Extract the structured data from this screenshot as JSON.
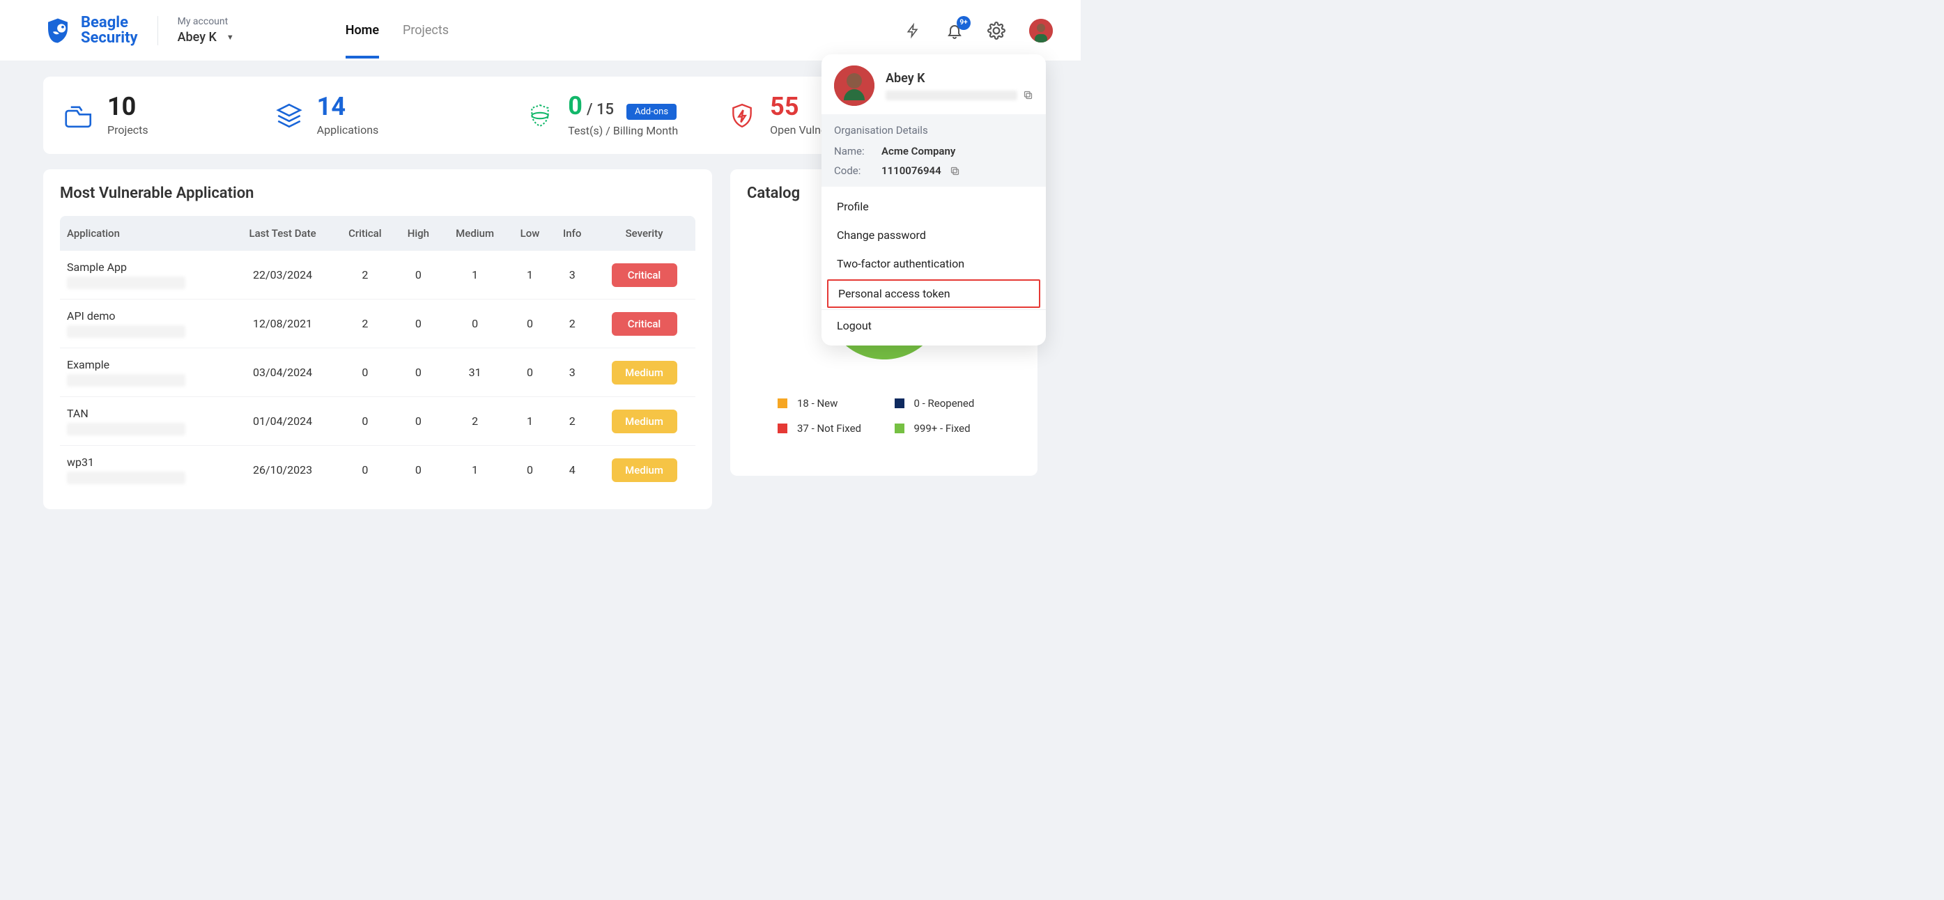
{
  "brand": {
    "line1": "Beagle",
    "line2": "Security"
  },
  "account": {
    "label": "My account",
    "name": "Abey K"
  },
  "nav": {
    "tabs": [
      {
        "label": "Home",
        "active": true
      },
      {
        "label": "Projects",
        "active": false
      }
    ]
  },
  "header": {
    "notif_badge": "9+"
  },
  "stats": {
    "projects": {
      "value": "10",
      "label": "Projects"
    },
    "applications": {
      "value": "14",
      "label": "Applications"
    },
    "tests": {
      "value": "0",
      "total": "/ 15",
      "label": "Test(s) / Billing Month",
      "addons_label": "Add-ons"
    },
    "vulnerabilities": {
      "value": "55",
      "label": "Open Vulnerabilities"
    }
  },
  "vuln_panel": {
    "title": "Most Vulnerable Application",
    "columns": [
      "Application",
      "Last Test Date",
      "Critical",
      "High",
      "Medium",
      "Low",
      "Info",
      "Severity"
    ],
    "rows": [
      {
        "app": "Sample App",
        "date": "22/03/2024",
        "critical": "2",
        "high": "0",
        "medium": "1",
        "low": "1",
        "info": "3",
        "severity": "Critical",
        "sev_class": "sev-critical"
      },
      {
        "app": "API demo",
        "date": "12/08/2021",
        "critical": "2",
        "high": "0",
        "medium": "0",
        "low": "0",
        "info": "2",
        "severity": "Critical",
        "sev_class": "sev-critical"
      },
      {
        "app": "Example",
        "date": "03/04/2024",
        "critical": "0",
        "high": "0",
        "medium": "31",
        "low": "0",
        "info": "3",
        "severity": "Medium",
        "sev_class": "sev-medium"
      },
      {
        "app": "TAN",
        "date": "01/04/2024",
        "critical": "0",
        "high": "0",
        "medium": "2",
        "low": "1",
        "info": "2",
        "severity": "Medium",
        "sev_class": "sev-medium"
      },
      {
        "app": "wp31",
        "date": "26/10/2023",
        "critical": "0",
        "high": "0",
        "medium": "1",
        "low": "0",
        "info": "4",
        "severity": "Medium",
        "sev_class": "sev-medium"
      }
    ]
  },
  "catalog": {
    "title": "Catalog",
    "legend": [
      {
        "color": "#f6a623",
        "text": "18 - New"
      },
      {
        "color": "#0f2a5f",
        "text": "0 - Reopened"
      },
      {
        "color": "#e53935",
        "text": "37 - Not Fixed"
      },
      {
        "color": "#76c043",
        "text": "999+ - Fixed"
      }
    ],
    "donut_segments": [
      {
        "color": "#76c043",
        "pct": 94
      },
      {
        "color": "#f6a623",
        "pct": 2
      },
      {
        "color": "#e53935",
        "pct": 4
      }
    ]
  },
  "chart_data": {
    "type": "pie",
    "title": "Catalog",
    "series": [
      {
        "name": "New",
        "value": 18,
        "color": "#f6a623"
      },
      {
        "name": "Reopened",
        "value": 0,
        "color": "#0f2a5f"
      },
      {
        "name": "Not Fixed",
        "value": 37,
        "color": "#e53935"
      },
      {
        "name": "Fixed",
        "value": 999,
        "display": "999+",
        "color": "#76c043"
      }
    ]
  },
  "profile_menu": {
    "user_name": "Abey K",
    "org_title": "Organisation Details",
    "org_name_label": "Name:",
    "org_name_value": "Acme Company",
    "org_code_label": "Code:",
    "org_code_value": "1110076944",
    "items": {
      "profile": "Profile",
      "change_pw": "Change password",
      "two_fa": "Two-factor authentication",
      "pat": "Personal access token",
      "logout": "Logout"
    }
  }
}
